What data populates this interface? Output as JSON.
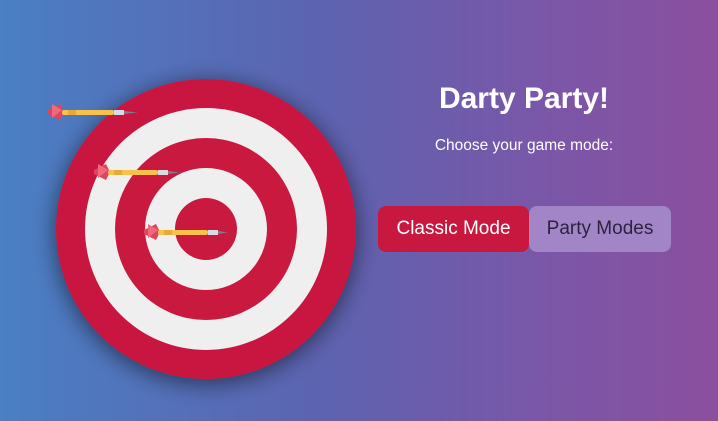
{
  "app": {
    "title": "Darty Party!",
    "subtitle": "Choose your game mode:"
  },
  "modes": {
    "classic_label": "Classic Mode",
    "party_label": "Party Modes"
  },
  "colors": {
    "board_red": "#c9193f",
    "board_white": "#efefef",
    "classic_button": "#c8183f",
    "party_button": "#a285c6",
    "gradient_left": "#4a7fc4",
    "gradient_right": "#8b4f9f"
  },
  "icons": {
    "board": "dartboard-icon",
    "dart": "dart-icon"
  }
}
